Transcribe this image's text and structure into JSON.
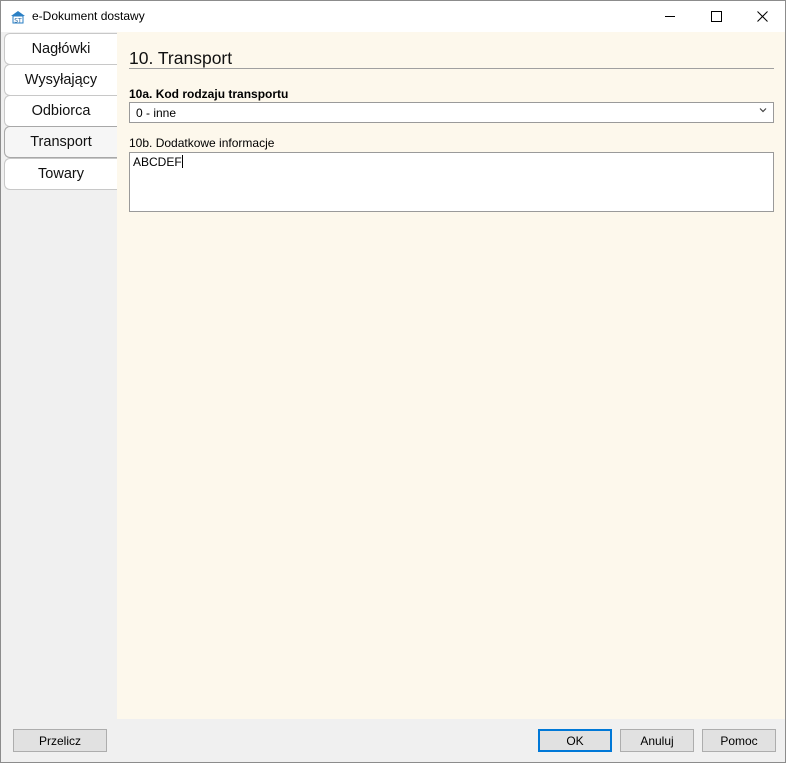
{
  "window": {
    "title": "e-Dokument dostawy",
    "icon": "app-logo-icon",
    "controls": {
      "minimize": "—",
      "maximize": "☐",
      "close": "✕"
    }
  },
  "tabs": [
    {
      "label": "Nagłówki",
      "active": false
    },
    {
      "label": "Wysyłający",
      "active": false
    },
    {
      "label": "Odbiorca",
      "active": false
    },
    {
      "label": "Transport",
      "active": true
    },
    {
      "label": "Towary",
      "active": false
    }
  ],
  "section": {
    "title": "10. Transport",
    "transport_code": {
      "label": "10a. Kod rodzaju transportu",
      "selected": "0 - inne"
    },
    "additional_info": {
      "label": "10b. Dodatkowe informacje",
      "value": "ABCDEF"
    }
  },
  "footer": {
    "recalc_label": "Przelicz",
    "ok_label": "OK",
    "cancel_label": "Anuluj",
    "help_label": "Pomoc"
  },
  "colors": {
    "content_background": "#fdf8ec",
    "focus_border": "#0078d7"
  }
}
